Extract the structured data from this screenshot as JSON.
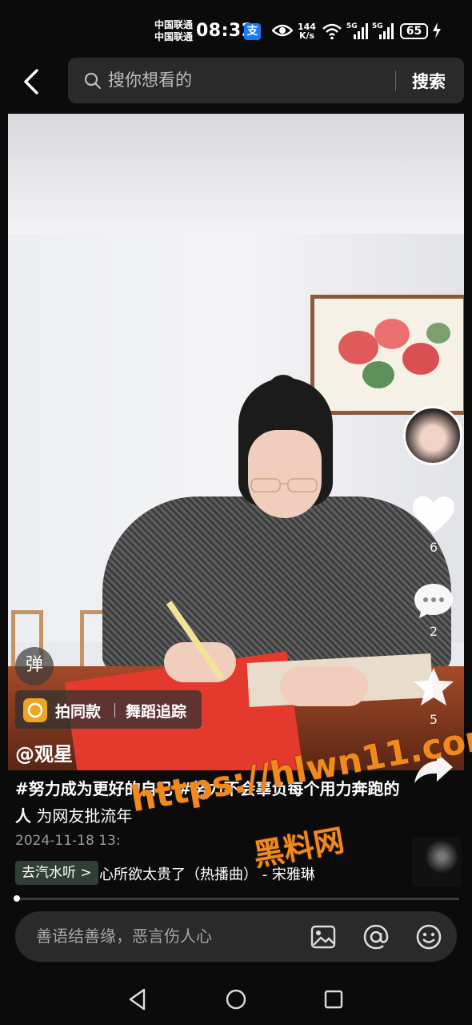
{
  "status_bar": {
    "carrier_1": "中国联通",
    "carrier_2": "中国联通",
    "time": "08:32",
    "alipay_glyph": "支",
    "speed_value": "144",
    "speed_unit": "K/s",
    "net_1": "5G",
    "net_2": "5G",
    "battery": "65",
    "icons": [
      "alipay-icon",
      "eye-icon",
      "wifi-icon",
      "signal-icon",
      "signal-icon",
      "battery-icon",
      "charging-icon"
    ]
  },
  "search": {
    "placeholder": "搜你想看的",
    "button_label": "搜索"
  },
  "video": {
    "danmu_label": "弹",
    "tags": {
      "shoot_same": "拍同款",
      "dance_track": "舞蹈追踪"
    }
  },
  "sidebar": {
    "like_count": "6",
    "comment_count": "2",
    "favorite_count": "5",
    "icons": [
      "heart-icon",
      "comment-icon",
      "star-icon",
      "share-icon"
    ]
  },
  "post": {
    "author": "@观星",
    "hashtags": "#努力成为更好的自己 #努力不会辜负每个用力奔跑的人",
    "description": " 为网友批流年",
    "date": "2024-11-18 13:",
    "music_tag": "去汽水听 >",
    "music_text": "心所欲太贵了（热播曲） - 宋雅琳"
  },
  "watermark": {
    "line_1": "https://hlwn11.com",
    "line_2": "黑料网"
  },
  "progress": {
    "played_fraction": 0.005
  },
  "comment": {
    "placeholder": "善语结善缘，恶言伤人心",
    "icons": [
      "image-icon",
      "at-icon",
      "emoji-icon"
    ]
  },
  "nav": {
    "icons": [
      "back-triangle-icon",
      "home-circle-icon",
      "recents-square-icon"
    ]
  },
  "colors": {
    "background": "#0b0b0b",
    "search_bg": "#2a2a2a",
    "watermark": "#f08a1e",
    "alipay_blue": "#1677ff",
    "music_tag_bg": "#2f3f36"
  }
}
